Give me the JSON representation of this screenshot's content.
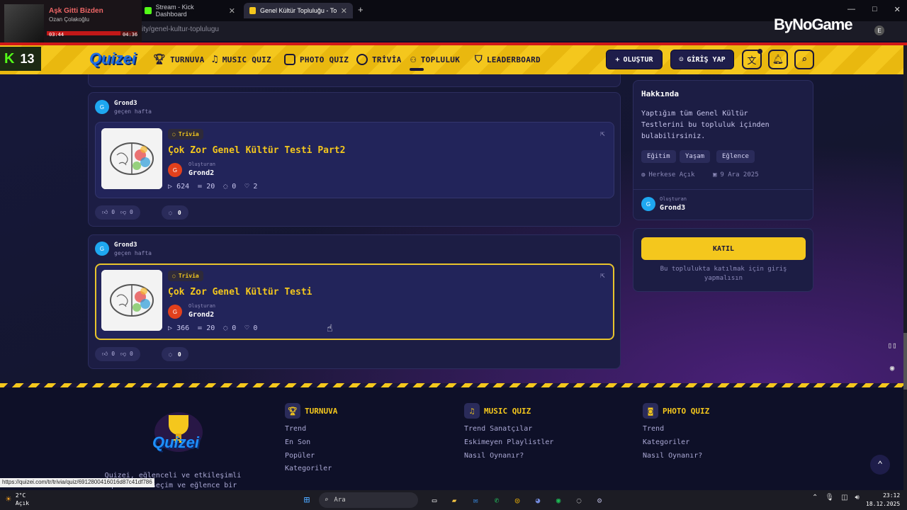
{
  "browser": {
    "tabs": [
      {
        "label": "Stream - Kick Dashboard"
      },
      {
        "label": "Genel Kültür Topluluğu - Toplu"
      }
    ],
    "url": "ity/genel-kultur-toplulugu",
    "status_url": "https://quizei.com/tr/trivia/quiz/6912800416016d87c41df786"
  },
  "media": {
    "title": "Aşk Gitti Bizden",
    "artist": "Ozan Çolakoğlu",
    "time_now": "03:44",
    "time_total": "04:36",
    "progress": 0.81
  },
  "overlay": {
    "brand": "ByNoGame",
    "kick_count": "13"
  },
  "nav": {
    "logo": "Quizei",
    "items": [
      {
        "label": "TURNUVA"
      },
      {
        "label": "MUSIC QUIZ"
      },
      {
        "label": "PHOTO QUIZ"
      },
      {
        "label": "TRİVİA"
      },
      {
        "label": "TOPLULUK"
      },
      {
        "label": "LEADERBOARD"
      }
    ],
    "create_label": "OLUŞTUR",
    "login_label": "GİRİŞ YAP"
  },
  "feed": [
    {
      "user": "Grond3",
      "avatar": "G",
      "time": "geçen hafta",
      "quiz": {
        "badge": "Trivia",
        "title": "Çok Zor Genel Kültür Testi Part2",
        "creator_label": "Oluşturan",
        "creator": "Grond2",
        "creator_avatar": "G",
        "plays": "624",
        "questions": "20",
        "comments": "0",
        "likes": "2"
      },
      "likes": "0",
      "dislikes": "0",
      "comment_count": "0"
    },
    {
      "user": "Grond3",
      "avatar": "G",
      "time": "geçen hafta",
      "quiz": {
        "badge": "Trivia",
        "title": "Çok Zor Genel Kültür Testi",
        "creator_label": "Oluşturan",
        "creator": "Grond2",
        "creator_avatar": "G",
        "plays": "366",
        "questions": "20",
        "comments": "0",
        "likes": "0"
      },
      "likes": "0",
      "dislikes": "0",
      "comment_count": "0"
    }
  ],
  "sidebar": {
    "about_title": "Hakkında",
    "description": "Yaptığım tüm Genel Kültür Testlerini bu topluluk içinden bulabilirsiniz.",
    "tags": [
      "Eğitim",
      "Yaşam",
      "Eğlence"
    ],
    "visibility": "Herkese Açık",
    "date": "9 Ara 2025",
    "creator_label": "Oluşturan",
    "creator": "Grond3",
    "creator_avatar": "G",
    "join_label": "KATIL",
    "join_note": "Bu toplulukta katılmak için giriş yapmalısın"
  },
  "footer": {
    "logo": "Quizei",
    "tagline": "Quizei, eğlenceli ve etkileşimli quizlerin seçim ve eğlence bir",
    "columns": [
      {
        "title": "TURNUVA",
        "links": [
          "Trend",
          "En Son",
          "Popüler",
          "Kategoriler"
        ]
      },
      {
        "title": "MUSIC QUIZ",
        "links": [
          "Trend Sanatçılar",
          "Eskimeyen Playlistler",
          "Nasıl Oynanır?"
        ]
      },
      {
        "title": "PHOTO QUIZ",
        "links": [
          "Trend",
          "Kategoriler",
          "Nasıl Oynanır?"
        ]
      }
    ]
  },
  "taskbar": {
    "temp": "2°C",
    "weather": "Açık",
    "search": "Ara",
    "time": "23:12",
    "date": "18.12.2025"
  },
  "colors": {
    "accent": "#f4c71d",
    "bg": "#14162f",
    "card": "#1c1d44"
  }
}
